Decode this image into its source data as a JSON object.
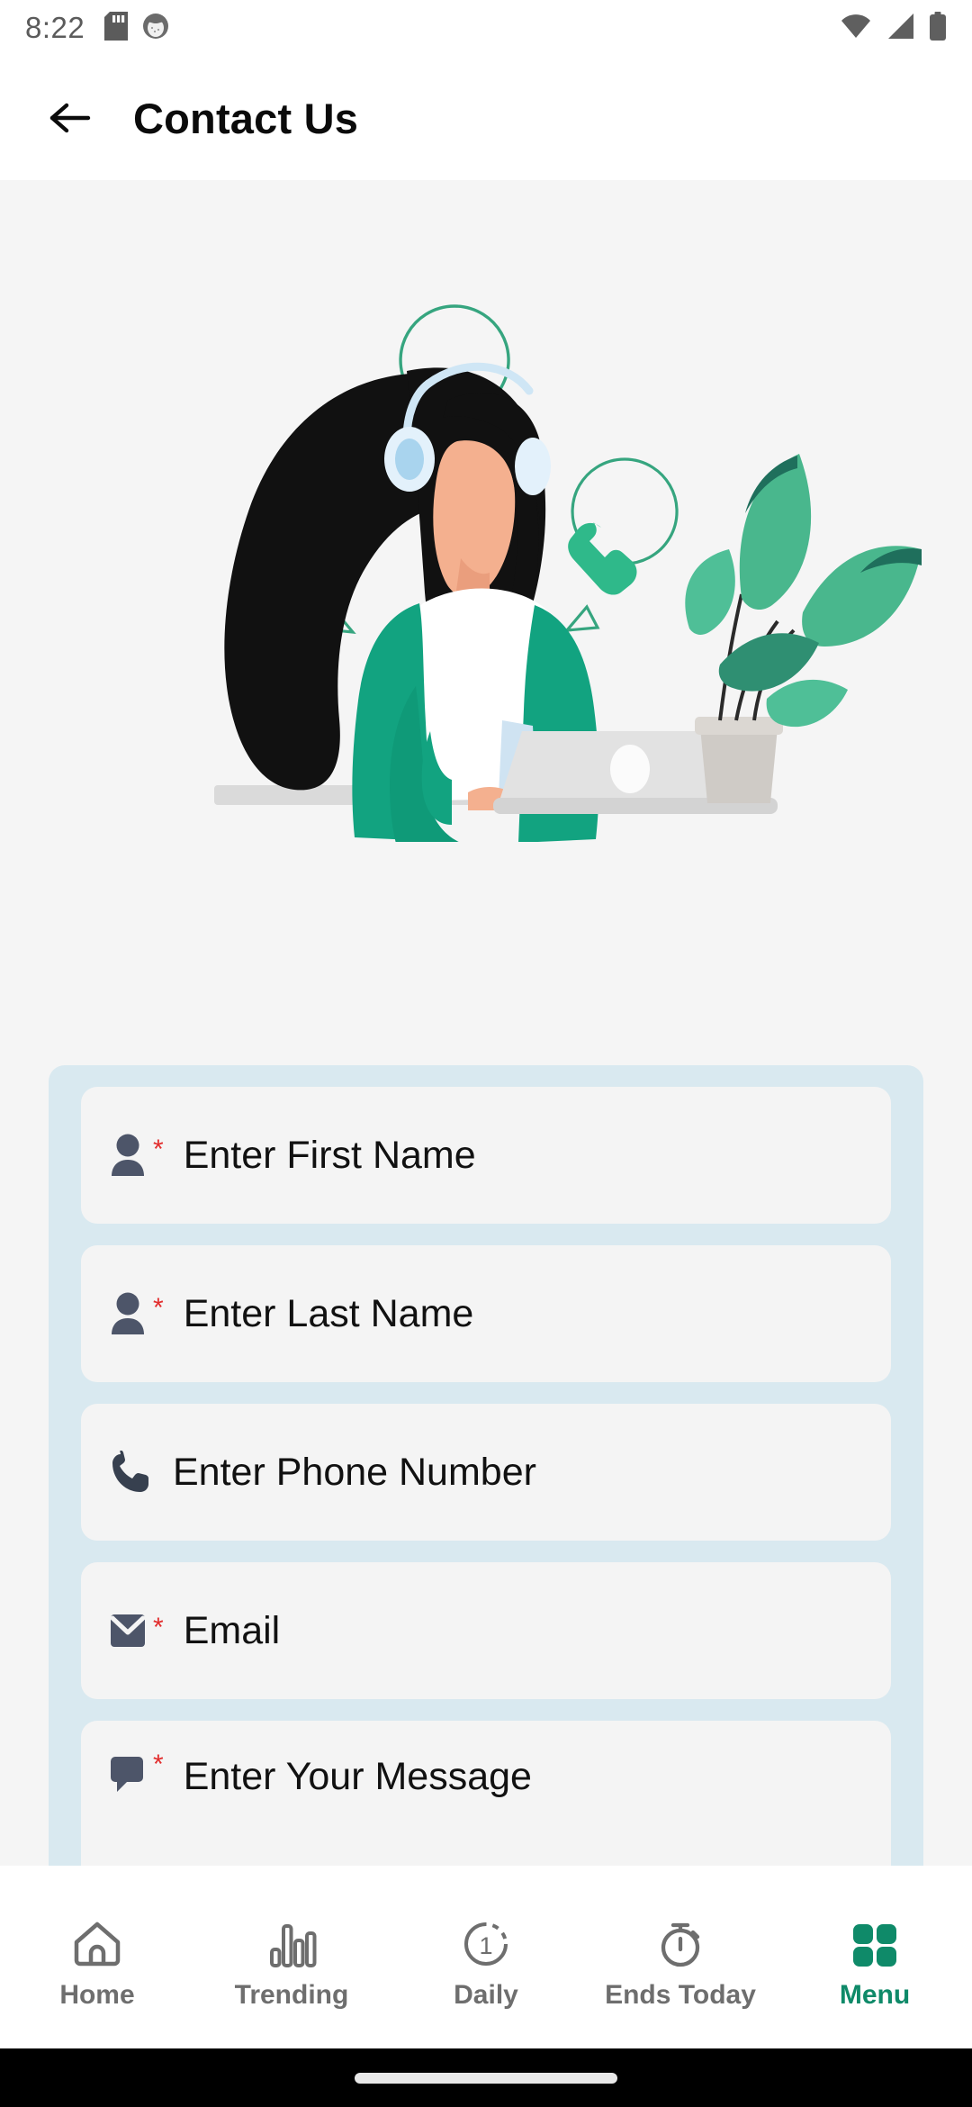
{
  "status_bar": {
    "time": "8:22",
    "left_icons": [
      "sd-card-icon",
      "app-notification-icon"
    ],
    "right_icons": [
      "wifi-icon",
      "cellular-signal-icon",
      "battery-icon"
    ]
  },
  "app_bar": {
    "back_icon": "back-arrow-icon",
    "title": "Contact Us"
  },
  "hero": {
    "illustration_name": "customer-support-agent-illustration",
    "bubbles": [
      {
        "name": "location-bubble",
        "icon": "location-pin-icon"
      },
      {
        "name": "mail-bubble",
        "icon": "envelope-icon"
      },
      {
        "name": "phone-bubble",
        "icon": "phone-handset-icon"
      }
    ],
    "background_color": "#F5F5F5",
    "accent_color": "#2CBB8C"
  },
  "form": {
    "panel_color": "#D9E9F0",
    "field_color": "#F4F4F4",
    "required_marker": "*",
    "required_marker_color": "#E22D2D",
    "fields": [
      {
        "name": "first-name-field",
        "icon": "person-icon",
        "placeholder": "Enter First Name",
        "required": true,
        "value": "",
        "type": "text"
      },
      {
        "name": "last-name-field",
        "icon": "person-icon",
        "placeholder": "Enter Last Name",
        "required": true,
        "value": "",
        "type": "text"
      },
      {
        "name": "phone-field",
        "icon": "phone-icon",
        "placeholder": "Enter Phone Number",
        "required": false,
        "value": "",
        "type": "tel"
      },
      {
        "name": "email-field",
        "icon": "envelope-icon",
        "placeholder": "Email",
        "required": true,
        "value": "",
        "type": "email"
      },
      {
        "name": "message-field",
        "icon": "chat-bubble-icon",
        "placeholder": "Enter Your Message",
        "required": true,
        "value": "",
        "type": "textarea"
      }
    ]
  },
  "bottom_nav": {
    "active_color": "#0F8A69",
    "inactive_color": "#6E6E6E",
    "items": [
      {
        "name": "nav-home",
        "label": "Home",
        "icon": "home-icon",
        "active": false
      },
      {
        "name": "nav-trending",
        "label": "Trending",
        "icon": "bar-chart-icon",
        "active": false
      },
      {
        "name": "nav-daily",
        "label": "Daily",
        "icon": "daily-one-icon",
        "badge": "1",
        "active": false
      },
      {
        "name": "nav-ends-today",
        "label": "Ends Today",
        "icon": "stopwatch-icon",
        "active": false
      },
      {
        "name": "nav-menu",
        "label": "Menu",
        "icon": "grid-menu-icon",
        "active": true
      }
    ]
  },
  "gesture_bar": {
    "name": "gesture-pill"
  }
}
